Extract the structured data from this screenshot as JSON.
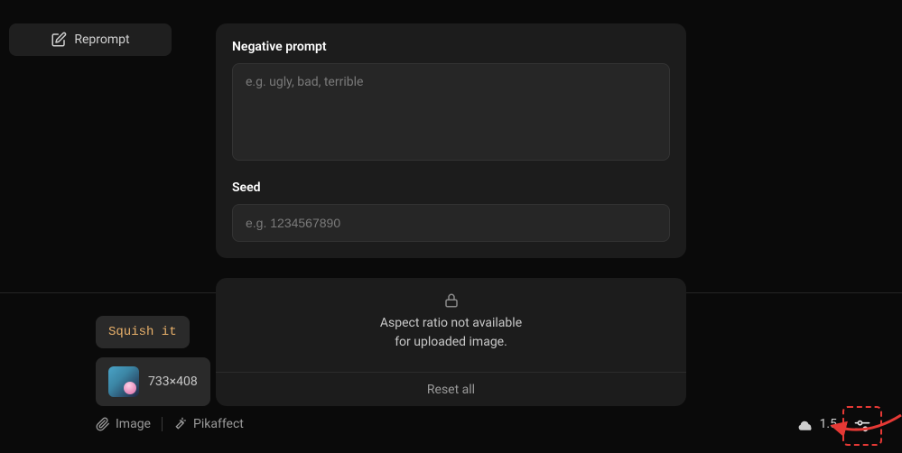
{
  "sidebar": {
    "reprompt_label": "Reprompt"
  },
  "panel": {
    "neg_label": "Negative prompt",
    "neg_placeholder": "e.g. ugly, bad, terrible",
    "seed_label": "Seed",
    "seed_placeholder": "e.g. 1234567890"
  },
  "aspect": {
    "line1": "Aspect ratio not available",
    "line2": "for uploaded image.",
    "reset_label": "Reset all"
  },
  "chips": {
    "squish": "Squish it",
    "dimensions": "733×408"
  },
  "bottom": {
    "image_label": "Image",
    "pikaffect_label": "Pikaffect",
    "score": "1.5"
  }
}
